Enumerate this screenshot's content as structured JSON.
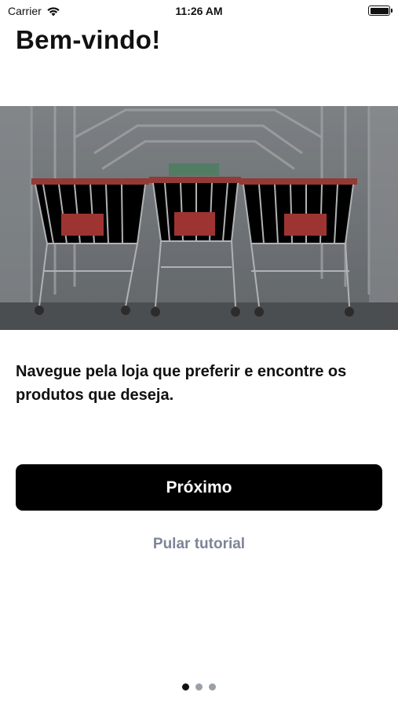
{
  "status_bar": {
    "carrier": "Carrier",
    "time": "11:26 AM",
    "wifi_icon": "wifi-icon",
    "battery_icon": "battery-full-icon",
    "battery_level": 1.0
  },
  "header": {
    "title": "Bem-vindo!"
  },
  "hero": {
    "image_subject": "shopping carts photo"
  },
  "content": {
    "description": "Navegue pela loja que preferir e encontre os produtos que deseja."
  },
  "actions": {
    "next_label": "Próximo",
    "skip_label": "Pular tutorial"
  },
  "pager": {
    "total": 3,
    "current": 1
  },
  "colors": {
    "primary_button": "#000000",
    "skip_link": "#7c8597",
    "dot_active": "#111111",
    "dot_inactive": "#9aa0a8"
  }
}
